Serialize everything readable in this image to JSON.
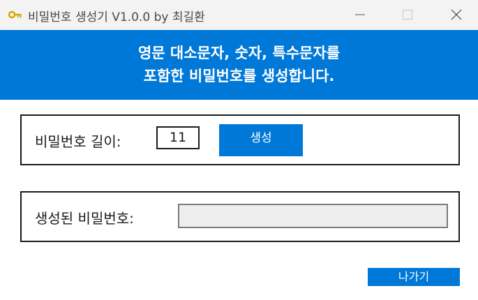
{
  "window": {
    "title": "비밀번호 생성기 V1.0.0 by 최길환",
    "icon": "key-icon"
  },
  "banner": {
    "line1": "영문 대소문자, 숫자, 특수문자를",
    "line2": "포함한 비밀번호를 생성합니다."
  },
  "length_group": {
    "label": "비밀번호 길이:",
    "value": "11",
    "generate_label": "생성"
  },
  "result_group": {
    "label": "생성된 비밀번호:",
    "value": ""
  },
  "exit_label": "나가기",
  "colors": {
    "accent": "#0078d7",
    "titlebar": "#f3f3f3",
    "result_field_bg": "#eeeeee"
  }
}
